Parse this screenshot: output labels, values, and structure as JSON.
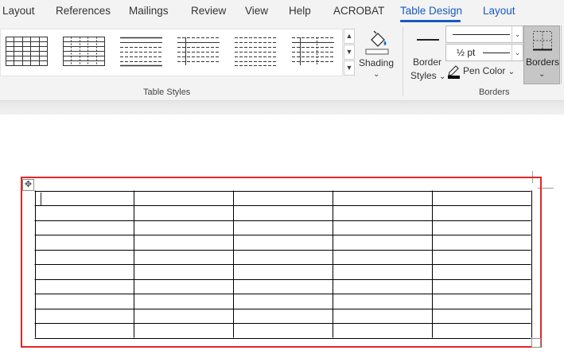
{
  "tabs": [
    {
      "name": "layout-tab",
      "label": "Layout"
    },
    {
      "name": "references-tab",
      "label": "References"
    },
    {
      "name": "mailings-tab",
      "label": "Mailings"
    },
    {
      "name": "review-tab",
      "label": "Review"
    },
    {
      "name": "view-tab",
      "label": "View"
    },
    {
      "name": "help-tab",
      "label": "Help"
    },
    {
      "name": "acrobat-tab",
      "label": "ACROBAT"
    },
    {
      "name": "table-design-tab",
      "label": "Table Design"
    },
    {
      "name": "table-layout-tab",
      "label": "Layout"
    }
  ],
  "ribbon": {
    "table_styles": {
      "label": "Table Styles"
    },
    "shading": {
      "label": "Shading"
    },
    "border_styles": {
      "label_line1": "Border",
      "label_line2": "Styles"
    },
    "line_weight": {
      "value": "½ pt"
    },
    "pen_color": {
      "label": "Pen Color",
      "color": "#000000"
    },
    "borders": {
      "label": "Borders",
      "group_label": "Borders"
    }
  },
  "icons": {
    "move_handle": "move-arrows-icon",
    "shading": "paint-bucket-icon",
    "pen_color": "pen-icon",
    "borders": "borders-grid-icon"
  },
  "document": {
    "table": {
      "rows": 10,
      "columns": 5
    },
    "selection_color": "#e02828"
  }
}
